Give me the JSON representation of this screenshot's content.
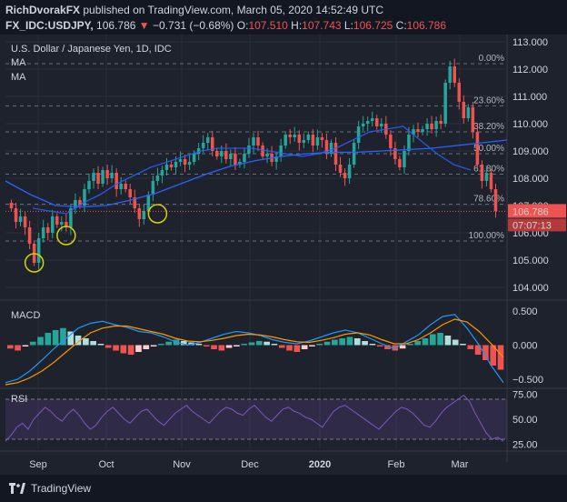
{
  "header": {
    "author": "RichDvorakFX",
    "published_text": "published on TradingView.com, March 05, 2020 14:52:49 UTC",
    "symbol": "FX_IDC:USDJPY,",
    "last": "106.786",
    "arrow": "▼",
    "change": "−0.731 (−0.68%)",
    "o_label": "O:",
    "o_value": "107.510",
    "h_label": "H:",
    "h_value": "107.743",
    "l_label": "L:",
    "l_value": "106.725",
    "c_label": "C:",
    "c_value": "106.786"
  },
  "pane_labels": {
    "title": "U.S. Dollar / Japanese Yen, 1D, IDC",
    "ma1": "MA",
    "ma2": "MA",
    "macd": "MACD",
    "rsi": "RSI"
  },
  "colors": {
    "up": "#26a69a",
    "down": "#ef5350",
    "ma_long": "#2962ff",
    "macd_line": "#2196f3",
    "signal_line": "#ff9800",
    "rsi_line": "#7e57c2",
    "circle": "#d4d400"
  },
  "chart_data": {
    "type": "candlestick",
    "price_axis": {
      "min": 103.6,
      "max": 113.2,
      "ticks": [
        "113.000",
        "112.000",
        "111.000",
        "110.000",
        "109.000",
        "108.000",
        "107.000",
        "106.000",
        "105.000",
        "104.000"
      ]
    },
    "x_labels": [
      "Sep",
      "Oct",
      "Nov",
      "Dec",
      "2020",
      "Feb",
      "Mar"
    ],
    "last_price_label": "106.786",
    "countdown_label": "07:07:13",
    "fib_levels": [
      {
        "label": "0.00%",
        "price": 112.2
      },
      {
        "label": "23.60%",
        "price": 110.65
      },
      {
        "label": "38.20%",
        "price": 109.7
      },
      {
        "label": "50.00%",
        "price": 108.9
      },
      {
        "label": "61.80%",
        "price": 108.15
      },
      {
        "label": "78.60%",
        "price": 107.05
      },
      {
        "label": "100.00%",
        "price": 105.7
      }
    ],
    "close_path": [
      106.9,
      106.4,
      106.6,
      106.2,
      105.6,
      104.9,
      105.8,
      106.2,
      106.0,
      106.6,
      106.3,
      106.4,
      106.2,
      106.9,
      107.2,
      107.0,
      107.6,
      107.9,
      108.2,
      107.8,
      108.3,
      108.0,
      108.2,
      107.6,
      107.8,
      107.6,
      107.3,
      106.9,
      106.5,
      106.8,
      107.4,
      107.9,
      108.1,
      108.3,
      108.5,
      108.4,
      108.6,
      108.7,
      108.5,
      108.6,
      108.9,
      109.1,
      109.3,
      109.5,
      109.0,
      108.8,
      109.0,
      108.7,
      108.9,
      108.5,
      108.6,
      108.9,
      109.2,
      109.5,
      109.2,
      108.8,
      108.9,
      108.6,
      108.8,
      109.2,
      109.6,
      109.5,
      109.6,
      109.3,
      109.4,
      109.6,
      109.2,
      109.5,
      109.4,
      108.9,
      109.3,
      108.5,
      108.2,
      108.0,
      108.5,
      109.3,
      109.9,
      110.0,
      110.1,
      110.2,
      109.9,
      110.0,
      109.6,
      109.1,
      108.7,
      108.4,
      109.0,
      109.6,
      109.8,
      109.7,
      109.8,
      110.0,
      109.8,
      110.1,
      110.0,
      111.5,
      112.1,
      111.5,
      110.8,
      110.2,
      110.6,
      109.7,
      108.5,
      107.9,
      108.2,
      107.6,
      106.8
    ],
    "ma_long": [
      107.9,
      107.4,
      107.0,
      106.95,
      107.0,
      107.2,
      107.45,
      107.8,
      108.15,
      108.45,
      108.65,
      108.8,
      108.9,
      108.95,
      108.95,
      109.0,
      109.05,
      109.1,
      109.2,
      109.3,
      109.4
    ],
    "ma_short": [
      106.9,
      106.8,
      106.7,
      107.1,
      107.4,
      107.8,
      108.1,
      108.4,
      108.6,
      108.8,
      109.0,
      109.1,
      109.1,
      109.1,
      109.0,
      108.9,
      108.8,
      108.9,
      109.1,
      109.4,
      109.7,
      109.8,
      109.9,
      109.4,
      108.9,
      108.5,
      108.3
    ],
    "circles": [
      {
        "bar": 5,
        "price": 104.9
      },
      {
        "bar": 12,
        "price": 105.9
      },
      {
        "bar": 32,
        "price": 106.7
      }
    ],
    "macd": {
      "axis": {
        "min": -0.62,
        "max": 0.62,
        "ticks": [
          "0.500",
          "0.000",
          "−0.500"
        ]
      },
      "histogram": [
        -0.05,
        -0.08,
        -0.02,
        0.05,
        0.12,
        0.18,
        0.22,
        0.25,
        0.2,
        0.14,
        0.1,
        0.06,
        0.02,
        -0.04,
        -0.08,
        -0.12,
        -0.14,
        -0.1,
        -0.06,
        -0.02,
        0.02,
        0.05,
        0.08,
        0.06,
        0.04,
        0.02,
        -0.02,
        -0.06,
        -0.08,
        -0.04,
        -0.02,
        0.02,
        0.04,
        0.06,
        0.05,
        0.02,
        -0.04,
        -0.08,
        -0.1,
        -0.06,
        -0.02,
        0.02,
        0.05,
        0.08,
        0.1,
        0.12,
        0.1,
        0.06,
        0.02,
        -0.02,
        -0.06,
        -0.08,
        -0.05,
        0.02,
        0.06,
        0.1,
        0.16,
        0.18,
        0.14,
        0.08,
        0.02,
        -0.06,
        -0.14,
        -0.22,
        -0.3,
        -0.36
      ],
      "macd_line": [
        -0.55,
        -0.5,
        -0.38,
        -0.22,
        -0.05,
        0.1,
        0.25,
        0.32,
        0.35,
        0.3,
        0.26,
        0.2,
        0.18,
        0.12,
        0.05,
        0.0,
        0.04,
        0.1,
        0.16,
        0.2,
        0.18,
        0.14,
        0.08,
        0.04,
        0.02,
        0.06,
        0.12,
        0.18,
        0.22,
        0.18,
        0.1,
        0.02,
        -0.05,
        0.05,
        0.15,
        0.3,
        0.42,
        0.45,
        0.25,
        0.0,
        -0.3,
        -0.55
      ],
      "signal_line": [
        -0.58,
        -0.55,
        -0.48,
        -0.38,
        -0.25,
        -0.1,
        0.05,
        0.18,
        0.25,
        0.28,
        0.28,
        0.24,
        0.2,
        0.16,
        0.1,
        0.06,
        0.05,
        0.07,
        0.1,
        0.14,
        0.16,
        0.15,
        0.12,
        0.08,
        0.05,
        0.04,
        0.07,
        0.11,
        0.16,
        0.18,
        0.15,
        0.08,
        0.02,
        0.02,
        0.08,
        0.18,
        0.3,
        0.38,
        0.34,
        0.2,
        0.02,
        -0.18
      ]
    },
    "rsi": {
      "axis": {
        "min": 20,
        "max": 80,
        "ticks": [
          "75.00",
          "50.00",
          "25.00"
        ]
      },
      "overbought": 70,
      "oversold": 30,
      "values": [
        28,
        34,
        42,
        46,
        40,
        50,
        56,
        62,
        58,
        52,
        48,
        55,
        60,
        54,
        46,
        40,
        44,
        52,
        58,
        62,
        56,
        50,
        46,
        52,
        58,
        60,
        54,
        48,
        44,
        50,
        56,
        60,
        64,
        58,
        54,
        50,
        46,
        52,
        58,
        62,
        60,
        56,
        54,
        60,
        64,
        58,
        52,
        48,
        54,
        60,
        62,
        58,
        56,
        52,
        50,
        46,
        42,
        50,
        58,
        62,
        64,
        60,
        56,
        52,
        48,
        44,
        40,
        46,
        52,
        58,
        62,
        60,
        56,
        50,
        44,
        42,
        48,
        56,
        62,
        66,
        70,
        74,
        68,
        56,
        46,
        36,
        30,
        32,
        28
      ]
    }
  },
  "footer": {
    "brand": "TradingView"
  }
}
